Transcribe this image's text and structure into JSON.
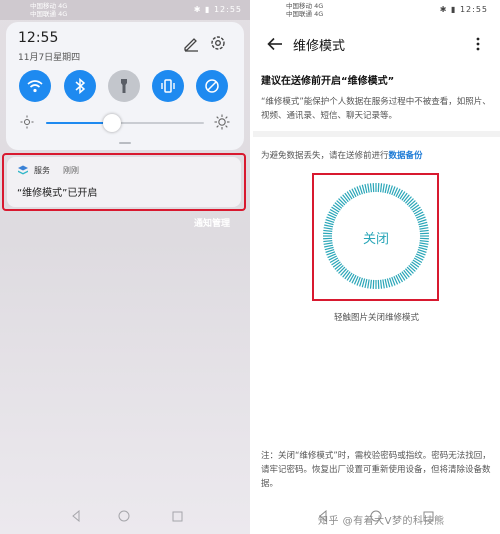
{
  "left": {
    "status_bar": {
      "carrier1": "中国移动 4G",
      "carrier2": "中国联通 4G",
      "right": "✱ ▮ 12:55"
    },
    "quick_settings": {
      "time": "12:55",
      "date": "11月7日星期四",
      "tiles": [
        "wifi-icon",
        "bluetooth-icon",
        "flashlight-icon",
        "vibrate-icon",
        "auto-rotate-icon"
      ],
      "tile_states": [
        true,
        true,
        false,
        true,
        true
      ],
      "brightness_level": 0.42,
      "accent": "#1e8af0"
    },
    "notification": {
      "app": "服务",
      "time": "刚刚",
      "message": "“维修模式”已开启",
      "manage_label": "通知管理"
    }
  },
  "right": {
    "status_bar": {
      "carrier1": "中国移动 4G",
      "carrier2": "中国联通 4G",
      "right": "✱ ▮ 12:55"
    },
    "title": "维修模式",
    "heading": "建议在送修前开启“维修模式”",
    "description": "“维修模式”能保护个人数据在服务过程中不被查看，如照片、视频、通讯录、短信、聊天记录等。",
    "backup_text": "为避免数据丢失，请在送修前进行",
    "backup_link": "数据备份",
    "dial_label": "关闭",
    "dial_caption": "轻触图片关闭维修模式",
    "note": "注：关闭“维修模式”时，需校验密码或指纹。密码无法找回，请牢记密码。恢复出厂设置可重新使用设备，但将清除设备数据。",
    "watermark": "知乎 @有着大V梦的科技熊",
    "dial_color": "#2aa6b8",
    "highlight_color": "#d8192f"
  }
}
